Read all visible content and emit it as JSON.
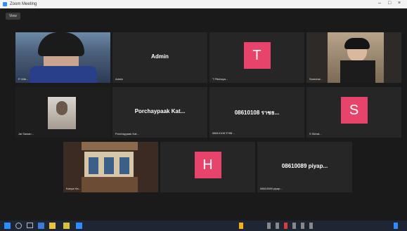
{
  "window": {
    "title": "Zoom Meeting"
  },
  "toolbar": {
    "view_label": "View"
  },
  "tiles": [
    {
      "name": "",
      "caption": "P. Mitr...",
      "type": "video"
    },
    {
      "name": "Admin",
      "caption": "Admin",
      "type": "name"
    },
    {
      "name": "T",
      "caption": "T Pitchaya...",
      "type": "avatar",
      "color": "#e8436b"
    },
    {
      "name": "",
      "caption": "Somchai...",
      "type": "video"
    },
    {
      "name": "",
      "caption": "Jai Sawan...",
      "type": "video"
    },
    {
      "name": "Porchaypaak Kat...",
      "caption": "Porchaypaak Kat...",
      "type": "name"
    },
    {
      "name": "08610108 ราชธ...",
      "caption": "08610108 ราชธ...",
      "type": "name"
    },
    {
      "name": "S",
      "caption": "S Sirirat...",
      "type": "avatar",
      "color": "#e8436b"
    },
    {
      "name": "",
      "caption": "Kanya Ha...",
      "type": "video"
    },
    {
      "name": "H",
      "caption": "H Hataichanok...",
      "type": "avatar",
      "color": "#e8436b"
    },
    {
      "name": "08610089 piyap...",
      "caption": "08610089 piyap...",
      "type": "name"
    }
  ],
  "colors": {
    "active_border": "#d9c23b",
    "tile_bg": "#262626",
    "accent": "#2d8cff"
  }
}
